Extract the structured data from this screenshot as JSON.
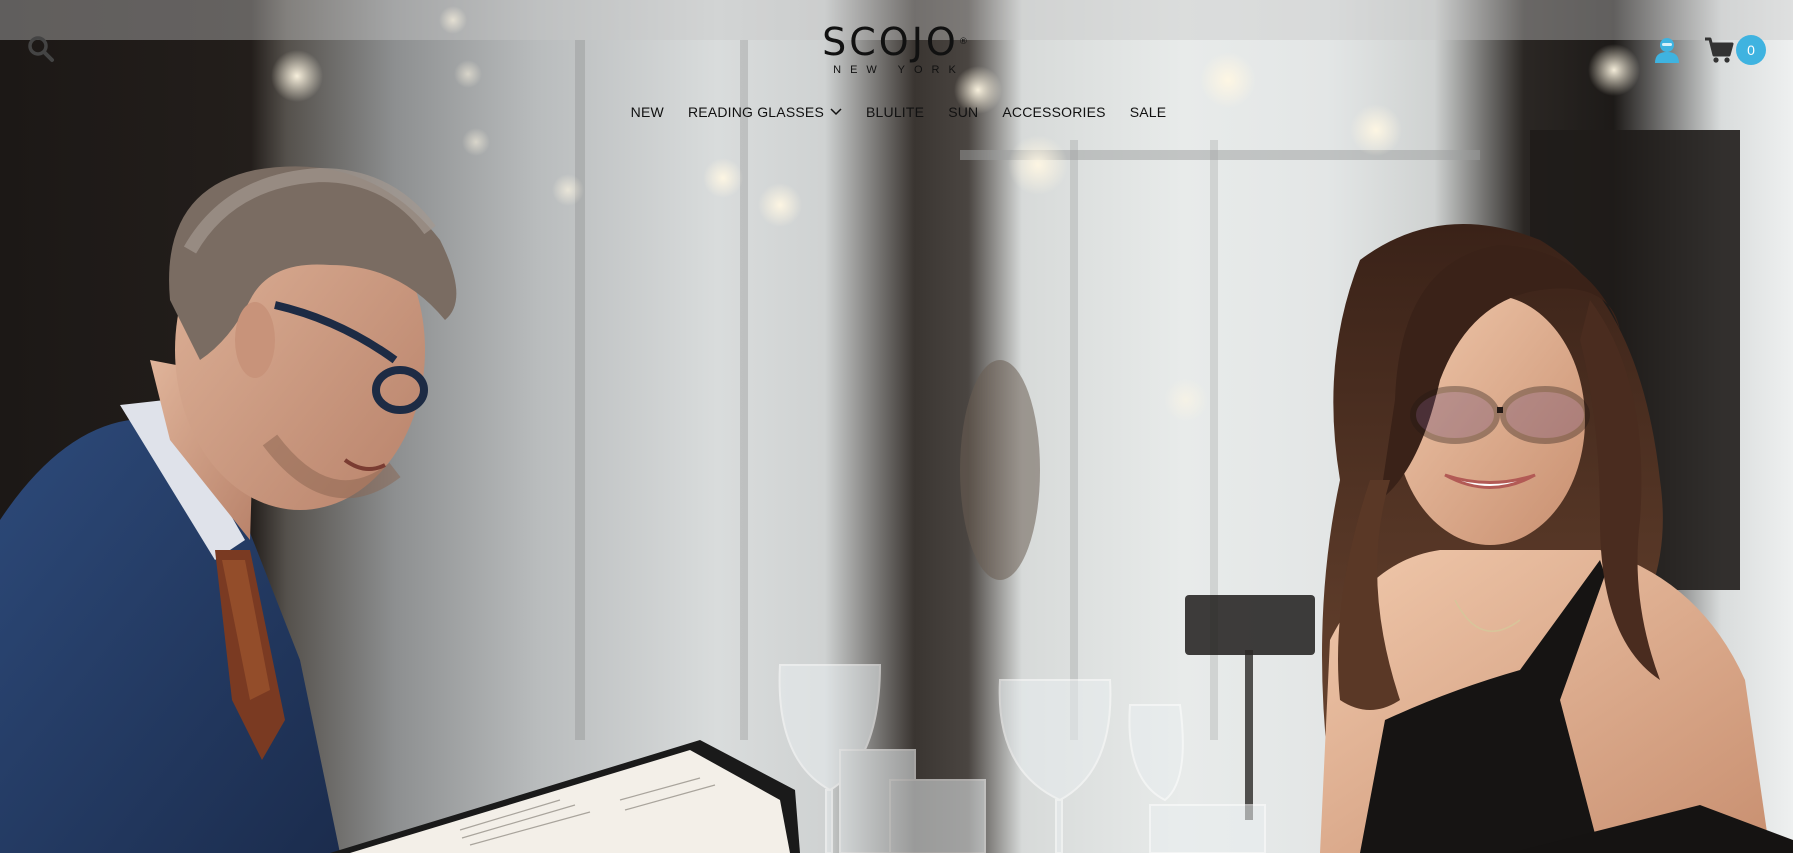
{
  "header": {
    "search_icon": "search-icon",
    "logo": {
      "main": "SCOJO",
      "mark": "®",
      "sub": "NEW YORK"
    },
    "account_icon": "user-icon",
    "cart_icon": "cart-icon",
    "cart_count": "0"
  },
  "nav": {
    "items": [
      {
        "label": "NEW"
      },
      {
        "label": "READING GLASSES",
        "has_dropdown": true
      },
      {
        "label": "BLULITE"
      },
      {
        "label": "SUN"
      },
      {
        "label": "ACCESSORIES"
      },
      {
        "label": "SALE"
      }
    ]
  },
  "colors": {
    "accent": "#3fb3e0",
    "text": "#111111"
  },
  "hero": {
    "image": "photo-man-and-woman-wearing-glasses-reading-menus-at-restaurant-bar"
  }
}
